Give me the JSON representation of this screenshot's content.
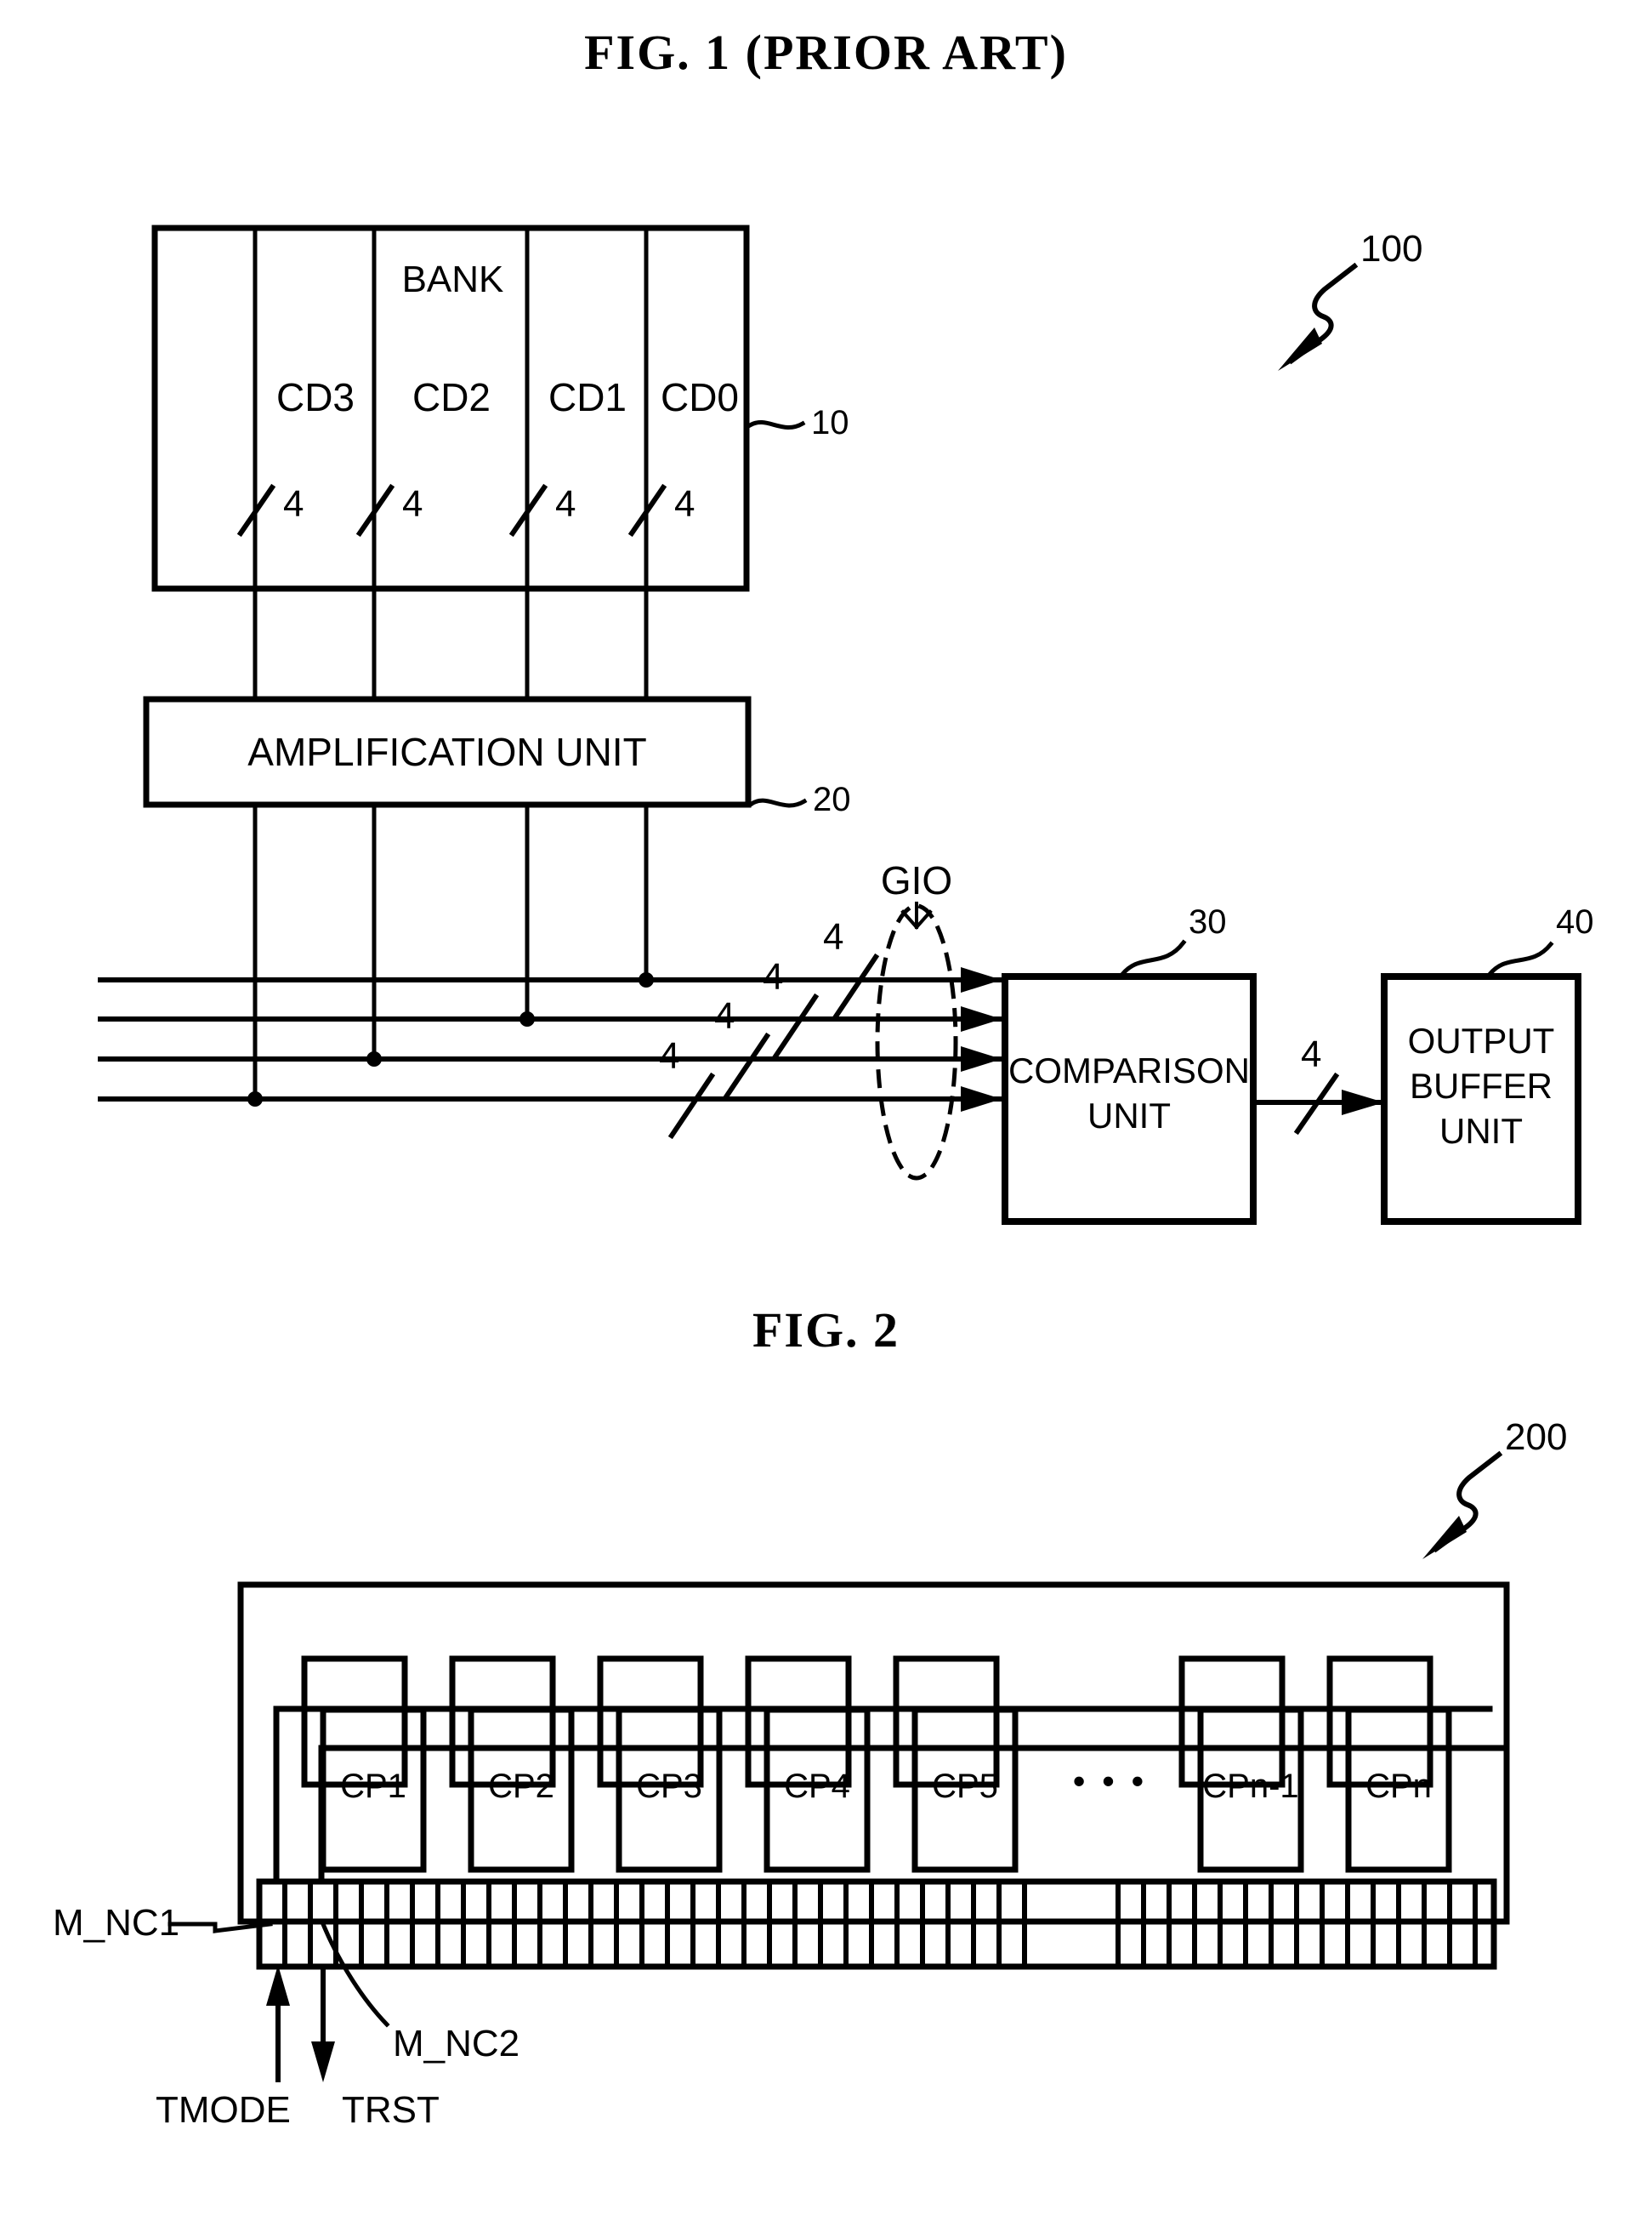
{
  "figures": [
    {
      "id": "fig1",
      "title": "FIG. 1 (PRIOR ART)",
      "system_ref": "100",
      "blocks": {
        "bank": {
          "label": "BANK",
          "ref": "10",
          "columns": [
            "CD3",
            "CD2",
            "CD1",
            "CD0"
          ],
          "bus_widths": [
            "4",
            "4",
            "4",
            "4"
          ]
        },
        "amplification": {
          "label": "AMPLIFICATION UNIT",
          "ref": "20"
        },
        "comparison": {
          "label_line1": "COMPARISON",
          "label_line2": "UNIT",
          "ref": "30"
        },
        "output_buffer": {
          "label_line1": "OUTPUT",
          "label_line2": "BUFFER",
          "label_line3": "UNIT",
          "ref": "40"
        }
      },
      "bus": {
        "gio_label": "GIO",
        "gio_widths": [
          "4",
          "4",
          "4",
          "4"
        ],
        "output_width": "4"
      }
    },
    {
      "id": "fig2",
      "title": "FIG. 2",
      "system_ref": "200",
      "cp_blocks": [
        "CP1",
        "CP2",
        "CP3",
        "CP4",
        "CP5",
        "CPn-1",
        "CPn"
      ],
      "ellipsis": "•  •  •",
      "signals": {
        "m_nc1": "M_NC1",
        "m_nc2": "M_NC2",
        "tmode": "TMODE",
        "trst": "TRST"
      }
    }
  ],
  "colors": {
    "ink": "#000000",
    "paper": "#ffffff"
  }
}
